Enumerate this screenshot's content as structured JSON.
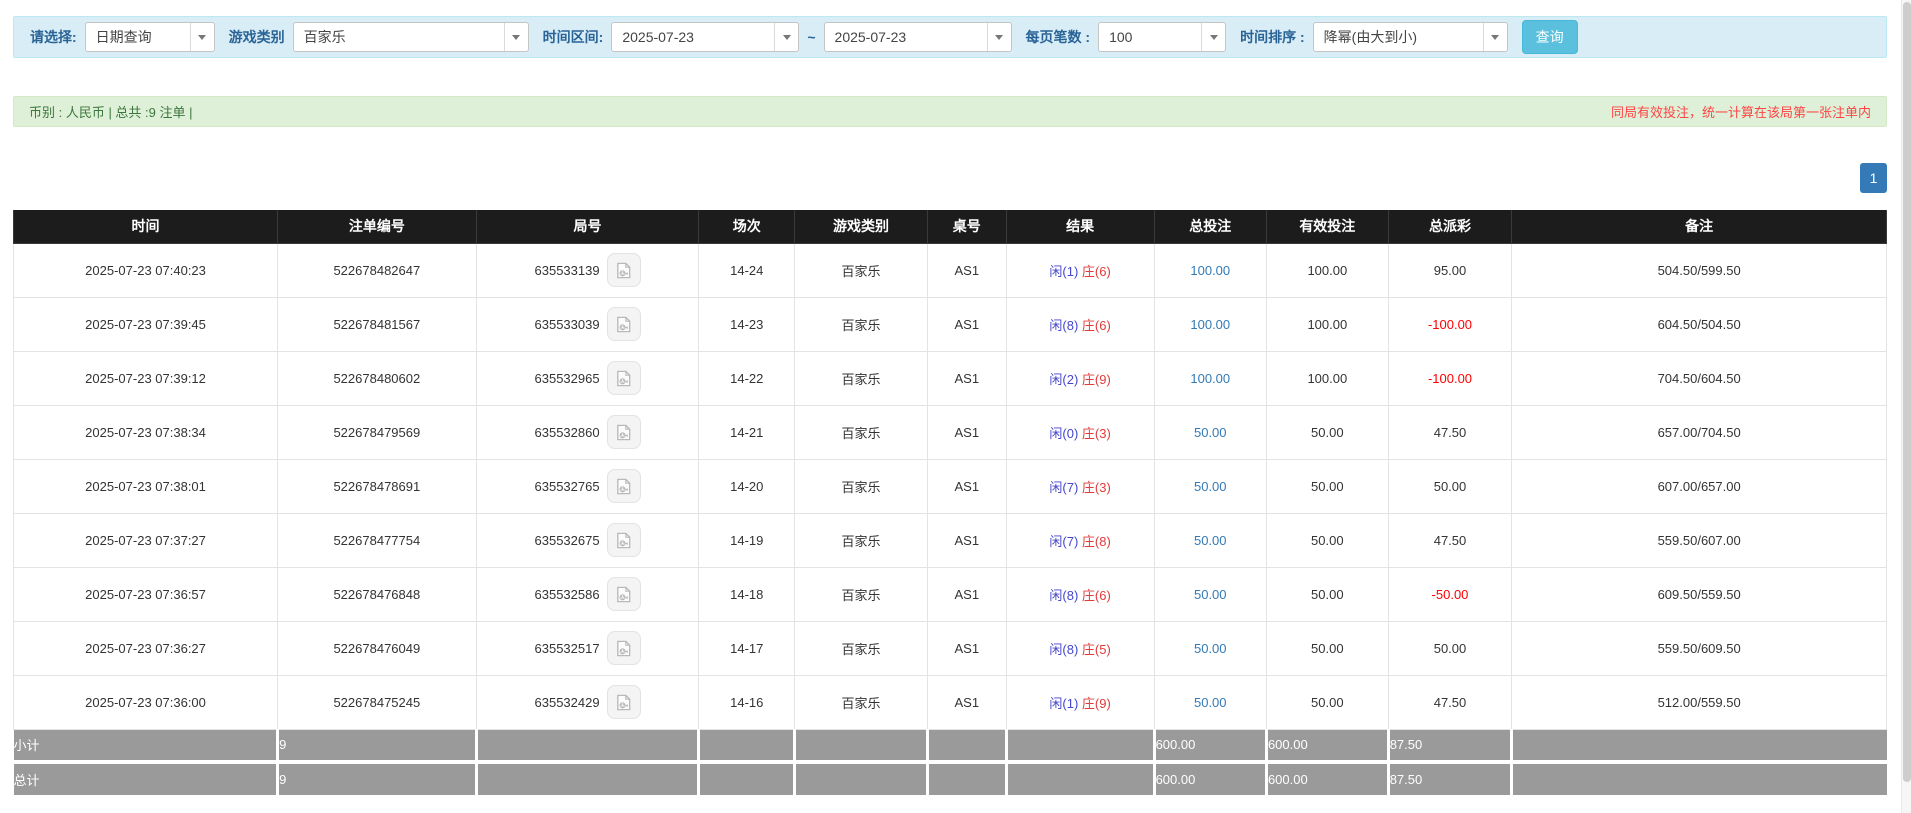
{
  "filter_bar": {
    "select_label": "请选择:",
    "select_value": "日期查询",
    "game_type_label": "游戏类别",
    "game_type_value": "百家乐",
    "time_range_label": "时间区间:",
    "date_from": "2025-07-23",
    "tilde": "~",
    "date_to": "2025-07-23",
    "page_size_label": "每页笔数 :",
    "page_size_value": "100",
    "sort_label": "时间排序 :",
    "sort_value": "降幂(由大到小)",
    "query_button": "查询"
  },
  "summary_bar": {
    "left_text": "币别 : 人民币 | 总共 :9 注单 |",
    "right_text": "同局有效投注，统一计算在该局第一张注单内"
  },
  "pagination": {
    "current_page": "1"
  },
  "colors": {
    "filter_bg": "#d9edf7",
    "summary_bg": "#dff0d8",
    "header_bg": "#1c1c1c",
    "sum_row_bg": "#9a9a9a",
    "player_blue": "#4646cc",
    "banker_red": "#e03b3b",
    "link_blue": "#337ab7",
    "negative_red": "#ff0000",
    "query_btn": "#5bc0de",
    "page_btn": "#337ab7"
  },
  "table": {
    "headers": [
      "时间",
      "注单编号",
      "局号",
      "场次",
      "游戏类别",
      "桌号",
      "结果",
      "总投注",
      "有效投注",
      "总派彩",
      "备注"
    ],
    "rows": [
      {
        "time": "2025-07-23 07:40:23",
        "bet_id": "522678482647",
        "round_id": "635533139",
        "session": "14-24",
        "game": "百家乐",
        "table_no": "AS1",
        "result_player": "闲(1)",
        "result_banker": "庄(6)",
        "total_bet": "100.00",
        "valid_bet": "100.00",
        "payout": "95.00",
        "remark": "504.50/599.50"
      },
      {
        "time": "2025-07-23 07:39:45",
        "bet_id": "522678481567",
        "round_id": "635533039",
        "session": "14-23",
        "game": "百家乐",
        "table_no": "AS1",
        "result_player": "闲(8)",
        "result_banker": "庄(6)",
        "total_bet": "100.00",
        "valid_bet": "100.00",
        "payout": "-100.00",
        "remark": "604.50/504.50"
      },
      {
        "time": "2025-07-23 07:39:12",
        "bet_id": "522678480602",
        "round_id": "635532965",
        "session": "14-22",
        "game": "百家乐",
        "table_no": "AS1",
        "result_player": "闲(2)",
        "result_banker": "庄(9)",
        "total_bet": "100.00",
        "valid_bet": "100.00",
        "payout": "-100.00",
        "remark": "704.50/604.50"
      },
      {
        "time": "2025-07-23 07:38:34",
        "bet_id": "522678479569",
        "round_id": "635532860",
        "session": "14-21",
        "game": "百家乐",
        "table_no": "AS1",
        "result_player": "闲(0)",
        "result_banker": "庄(3)",
        "total_bet": "50.00",
        "valid_bet": "50.00",
        "payout": "47.50",
        "remark": "657.00/704.50"
      },
      {
        "time": "2025-07-23 07:38:01",
        "bet_id": "522678478691",
        "round_id": "635532765",
        "session": "14-20",
        "game": "百家乐",
        "table_no": "AS1",
        "result_player": "闲(7)",
        "result_banker": "庄(3)",
        "total_bet": "50.00",
        "valid_bet": "50.00",
        "payout": "50.00",
        "remark": "607.00/657.00"
      },
      {
        "time": "2025-07-23 07:37:27",
        "bet_id": "522678477754",
        "round_id": "635532675",
        "session": "14-19",
        "game": "百家乐",
        "table_no": "AS1",
        "result_player": "闲(7)",
        "result_banker": "庄(8)",
        "total_bet": "50.00",
        "valid_bet": "50.00",
        "payout": "47.50",
        "remark": "559.50/607.00"
      },
      {
        "time": "2025-07-23 07:36:57",
        "bet_id": "522678476848",
        "round_id": "635532586",
        "session": "14-18",
        "game": "百家乐",
        "table_no": "AS1",
        "result_player": "闲(8)",
        "result_banker": "庄(6)",
        "total_bet": "50.00",
        "valid_bet": "50.00",
        "payout": "-50.00",
        "remark": "609.50/559.50"
      },
      {
        "time": "2025-07-23 07:36:27",
        "bet_id": "522678476049",
        "round_id": "635532517",
        "session": "14-17",
        "game": "百家乐",
        "table_no": "AS1",
        "result_player": "闲(8)",
        "result_banker": "庄(5)",
        "total_bet": "50.00",
        "valid_bet": "50.00",
        "payout": "50.00",
        "remark": "559.50/609.50"
      },
      {
        "time": "2025-07-23 07:36:00",
        "bet_id": "522678475245",
        "round_id": "635532429",
        "session": "14-16",
        "game": "百家乐",
        "table_no": "AS1",
        "result_player": "闲(1)",
        "result_banker": "庄(9)",
        "total_bet": "50.00",
        "valid_bet": "50.00",
        "payout": "47.50",
        "remark": "512.00/559.50"
      }
    ],
    "subtotal": {
      "label": "小计",
      "count": "9",
      "total_bet": "600.00",
      "valid_bet": "600.00",
      "payout": "87.50"
    },
    "total": {
      "label": "总计",
      "count": "9",
      "total_bet": "600.00",
      "valid_bet": "600.00",
      "payout": "87.50"
    }
  }
}
